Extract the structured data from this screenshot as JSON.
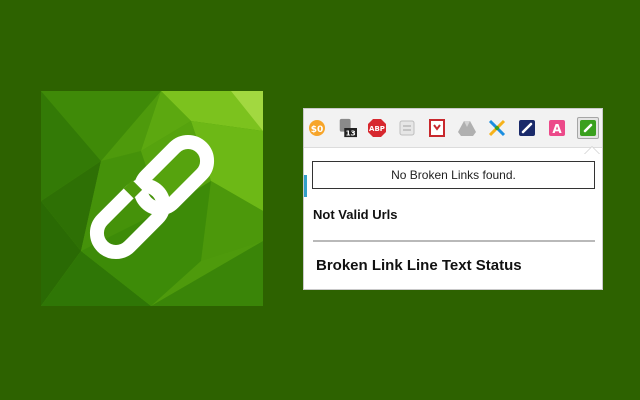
{
  "popup": {
    "status_message": "No Broken Links found.",
    "invalid_urls_heading": "Not Valid Urls",
    "line_status_heading": "Broken Link Line Text Status"
  },
  "toolbar": {
    "extensions": [
      {
        "name": "honey-extension",
        "glyph": "$0",
        "color": "#f28c1c"
      },
      {
        "name": "badge-extension",
        "glyph": "13",
        "color": "#333333"
      },
      {
        "name": "adblock-plus-extension",
        "glyph": "ABP",
        "color": "#d7282f"
      },
      {
        "name": "grey-extension",
        "glyph": "",
        "color": "#bbbbbb"
      },
      {
        "name": "red-extension",
        "glyph": "",
        "color": "#c8282d"
      },
      {
        "name": "google-drive-extension",
        "glyph": "",
        "color": "#9a9a9a"
      },
      {
        "name": "x-extension",
        "glyph": "",
        "color": "#1c8ee0"
      },
      {
        "name": "link-extension-dark",
        "glyph": "",
        "color": "#1a2a6a"
      },
      {
        "name": "a-extension",
        "glyph": "A",
        "color": "#ec4a8a"
      },
      {
        "name": "broken-link-checker-extension",
        "glyph": "",
        "color": "#3aa01e"
      }
    ]
  },
  "colors": {
    "background": "#2d6200",
    "logo_green": "#5aa80c",
    "logo_light": "#8fd030"
  }
}
